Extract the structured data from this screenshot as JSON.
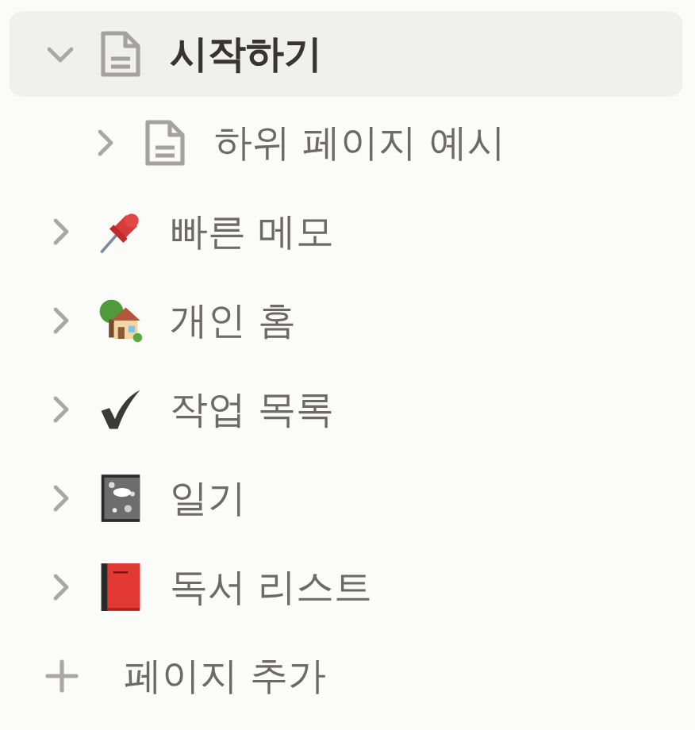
{
  "pages": [
    {
      "title": "시작하기",
      "kind": "page",
      "selected": true,
      "expanded": true,
      "children": [
        {
          "title": "하위 페이지 예시",
          "kind": "page",
          "selected": false,
          "expanded": false
        }
      ]
    },
    {
      "title": "빠른 메모",
      "kind": "pin",
      "selected": false,
      "expanded": false
    },
    {
      "title": "개인 홈",
      "kind": "house",
      "selected": false,
      "expanded": false
    },
    {
      "title": "작업 목록",
      "kind": "check",
      "selected": false,
      "expanded": false
    },
    {
      "title": "일기",
      "kind": "notebook",
      "selected": false,
      "expanded": false
    },
    {
      "title": "독서 리스트",
      "kind": "book",
      "selected": false,
      "expanded": false
    }
  ],
  "add_page": {
    "label": "페이지 추가"
  }
}
